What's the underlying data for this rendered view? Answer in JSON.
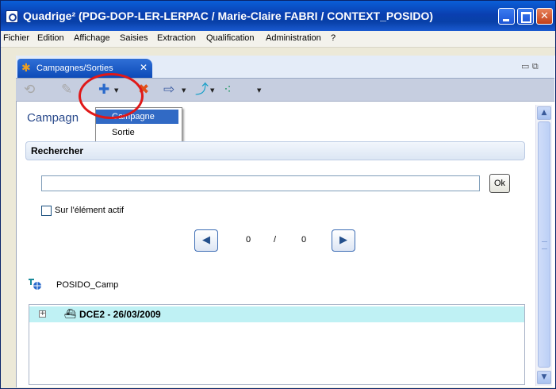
{
  "window": {
    "title": "Quadrige² (PDG-DOP-LER-LERPAC / Marie-Claire FABRI / CONTEXT_POSIDO)",
    "controls": {
      "minimize": "",
      "maximize": "",
      "close": "✕"
    }
  },
  "menubar": {
    "items": [
      "Fichier",
      "Edition",
      "Affichage",
      "Saisies",
      "Extraction",
      "Qualification",
      "Administration",
      "?"
    ]
  },
  "tab": {
    "label": "Campagnes/Sorties",
    "close": "✕",
    "view_controls": "▭ ⧉"
  },
  "toolbar": {
    "icons": [
      "back-icon",
      "edit-icon",
      "plus-icon",
      "delete-icon",
      "export-icon",
      "sort-icon",
      "filter-icon"
    ],
    "glyphs": {
      "back": "⟲",
      "edit": "✎",
      "plus": "✚",
      "delete": "✖",
      "export": "⇨",
      "sort": "⤴",
      "filter": "⁖",
      "dropdown": "▼"
    }
  },
  "heading": "Campagn",
  "popup_menu": {
    "items": [
      {
        "label": "Campagne",
        "selected": true
      },
      {
        "label": "Sortie",
        "selected": false
      }
    ]
  },
  "search": {
    "section_label": "Rechercher",
    "input_value": "",
    "ok_label": "Ok",
    "checkbox_label": "Sur l'élément actif",
    "checkbox_checked": false
  },
  "pagination": {
    "prev": "◀",
    "current": "0",
    "separator": "/",
    "total": "0",
    "next": "▶"
  },
  "context": {
    "label": "POSIDO_Camp"
  },
  "tree": {
    "rows": [
      {
        "expander": "+",
        "icon": "ship-icon",
        "glyph": "⛴",
        "label": "DCE2 - 26/03/2009",
        "highlighted": true
      }
    ]
  },
  "scrollbar": {
    "up": "▲",
    "down": "▼"
  },
  "colors": {
    "title_bar": "#0a46b8",
    "selection": "#316ac5",
    "annotation_circle": "#e01818",
    "tree_highlight": "#bff1f4",
    "toolbar": "#c6cee0",
    "add_icon": "#2a6acb",
    "delete_icon": "#e0501a"
  }
}
